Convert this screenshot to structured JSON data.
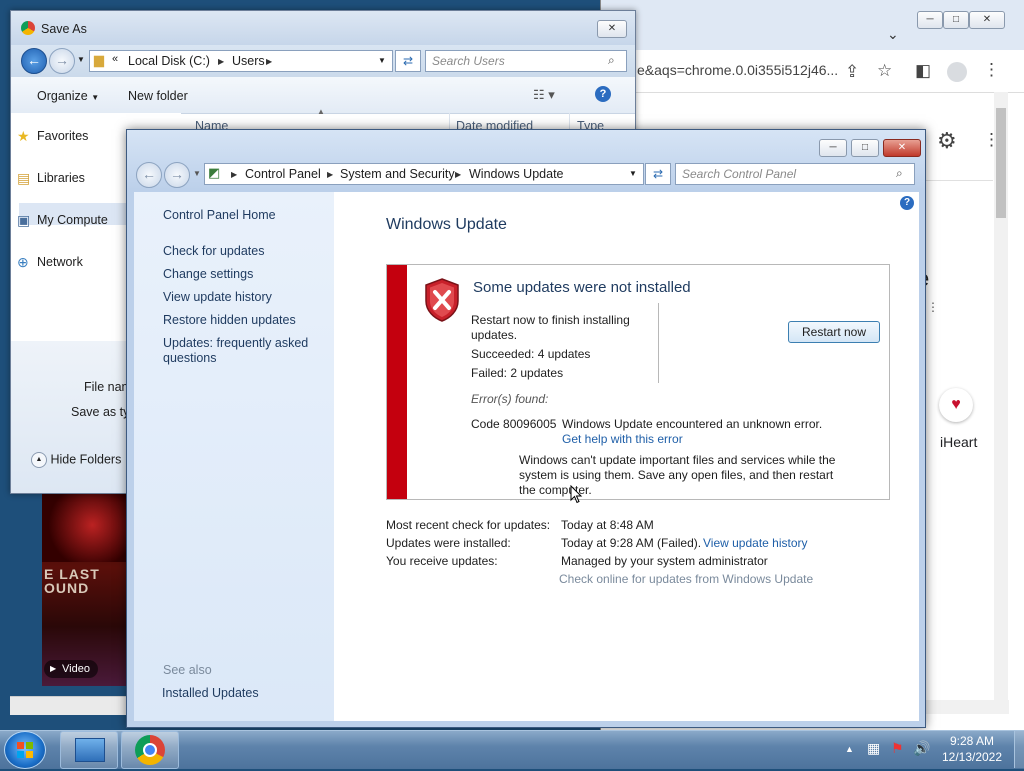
{
  "chrome": {
    "url": "e&aqs=chrome.0.0i355i512j46...",
    "partial_text_right": "e",
    "iheart_label": "iHeart"
  },
  "saveas": {
    "title": "Save As",
    "address": {
      "path": [
        "Local Disk (C:)",
        "Users"
      ]
    },
    "search_placeholder": "Search Users",
    "organize_label": "Organize",
    "new_folder_label": "New folder",
    "sidebar": [
      {
        "label": "Favorites",
        "icon": "star-icon"
      },
      {
        "label": "Libraries",
        "icon": "libraries-icon"
      },
      {
        "label": "My Compute",
        "icon": "computer-icon"
      },
      {
        "label": "Network",
        "icon": "network-icon"
      }
    ],
    "columns": [
      "Name",
      "Date modified",
      "Type"
    ],
    "file_name_label": "File nam",
    "save_as_type_label": "Save as typ",
    "hide_folders_label": "Hide Folders"
  },
  "video_thumb": {
    "text_line1": "E LAST",
    "text_line2": "OUND",
    "badge": "Video"
  },
  "control_panel": {
    "breadcrumb": [
      "Control Panel",
      "System and Security",
      "Windows Update"
    ],
    "search_placeholder": "Search Control Panel",
    "sidebar": {
      "home": "Control Panel Home",
      "links": [
        "Check for updates",
        "Change settings",
        "View update history",
        "Restore hidden updates",
        "Updates: frequently asked",
        "questions"
      ],
      "see_also": "See also",
      "installed_updates": "Installed Updates"
    },
    "page_title": "Windows Update",
    "status": {
      "heading": "Some updates were not installed",
      "restart_line1": "Restart now to finish installing",
      "restart_line2": "updates.",
      "succeeded": "Succeeded: 4 updates",
      "failed": "Failed: 2 updates",
      "errors_found": "Error(s) found:",
      "code": "Code 80096005",
      "error_msg": "Windows Update encountered an unknown error.",
      "help_link": "Get help with this error",
      "warn_line1": "Windows can't update important files and services while the",
      "warn_line2": "system is using them. Save any open files, and then restart",
      "warn_line3": "the computer.",
      "restart_button": "Restart now"
    },
    "info": {
      "recent_check_label": "Most recent check for updates:",
      "recent_check_value": "Today at 8:48 AM",
      "installed_label": "Updates were installed:",
      "installed_value": "Today at 9:28 AM (Failed).",
      "history_link": "View update history",
      "receive_label": "You receive updates:",
      "receive_value": "Managed by your system administrator",
      "check_online": "Check online for updates from Windows Update"
    }
  },
  "taskbar": {
    "time": "9:28 AM",
    "date": "12/13/2022"
  },
  "colors": {
    "error_red": "#c4000e",
    "link_blue": "#1f5fa8",
    "title_blue": "#1e3a5f"
  }
}
